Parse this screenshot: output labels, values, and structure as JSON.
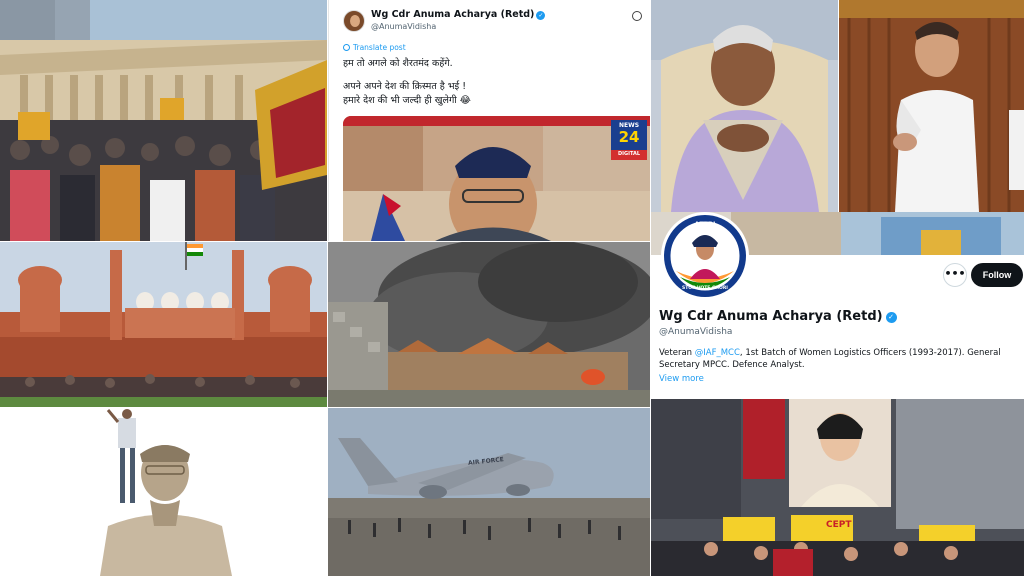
{
  "tweet": {
    "display_name": "Wg Cdr Anuma Acharya (Retd)",
    "handle": "@AnumaVidisha",
    "translate_label": "Translate post",
    "lines": [
      "हम तो अगले को शैरतमंद कहेंगे.",
      "अपने अपने देश की क़िस्मत है भई !",
      "हमारे देश की भी जल्दी ही खुलेगी 😂"
    ],
    "media": {
      "logo_number": "24",
      "logo_top": "NEWS",
      "logo_bottom": "DIGITAL"
    }
  },
  "profile": {
    "display_name": "Wg Cdr Anuma Acharya (Retd)",
    "handle": "@AnumaVidisha",
    "bio_prefix": "Veteran ",
    "bio_mention": "@IAF_MCC",
    "bio_suffix": ", 1st Batch of Women Logistics Officers (1993-2017). General Secretary MPCC. Defence Analyst.",
    "view_more": "View more",
    "follow_label": "Follow",
    "more_label": "•••",
    "avatar_ring_top": "AZADI",
    "avatar_ring_bottom": "STOP VOTE CHORI"
  },
  "collage": {
    "aircraft_marking": "AIR FORCE",
    "protest_sign": "CEPT"
  },
  "colors": {
    "verified": "#1d9bf0",
    "follow_bg": "#0f1419",
    "link": "#1d9bf0"
  }
}
